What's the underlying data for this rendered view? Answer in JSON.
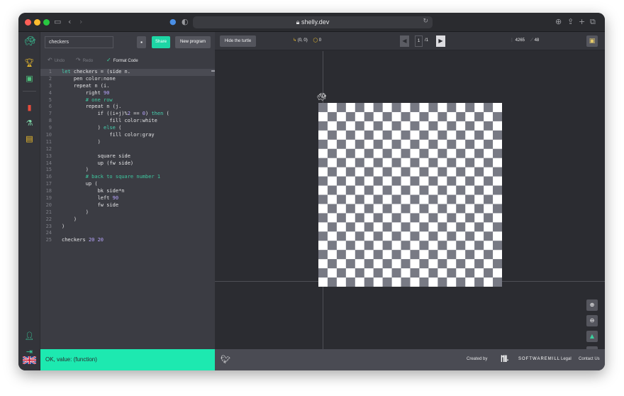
{
  "browser": {
    "url": "shelly.dev",
    "lock_icon": "lock-icon",
    "traffic_colors": [
      "#fe5f57",
      "#febc2e",
      "#28c840"
    ]
  },
  "sidebar": {
    "icons": [
      "logo-icon",
      "trophy-icon",
      "gallery-icon",
      "book-icon",
      "flask-icon",
      "teacher-icon",
      "user-settings-icon",
      "logout-icon"
    ]
  },
  "editor": {
    "program_name": "checkers",
    "share_label": "Share",
    "new_program_label": "New program",
    "undo_label": "Undo",
    "redo_label": "Redo",
    "format_label": "Format Code",
    "lines": [
      {
        "n": "1",
        "text": "let checkers = (side n.",
        "active": true
      },
      {
        "n": "2",
        "text": "    pen color:none"
      },
      {
        "n": "3",
        "text": "    repeat n (i."
      },
      {
        "n": "4",
        "text": "        right 90"
      },
      {
        "n": "5",
        "text": "        # one row",
        "comment": true
      },
      {
        "n": "6",
        "text": "        repeat n (j."
      },
      {
        "n": "7",
        "text": "            if ((i+j)%2 == 0) then ("
      },
      {
        "n": "8",
        "text": "                fill color:white"
      },
      {
        "n": "9",
        "text": "            ) else ("
      },
      {
        "n": "10",
        "text": "                fill color:gray"
      },
      {
        "n": "11",
        "text": "            )"
      },
      {
        "n": "12",
        "text": ""
      },
      {
        "n": "13",
        "text": "            square side"
      },
      {
        "n": "14",
        "text": "            up (fw side)"
      },
      {
        "n": "15",
        "text": "        )"
      },
      {
        "n": "16",
        "text": "        # back to square number 1",
        "comment": true
      },
      {
        "n": "17",
        "text": "        up ("
      },
      {
        "n": "18",
        "text": "            bk side*n"
      },
      {
        "n": "19",
        "text": "            left 90"
      },
      {
        "n": "20",
        "text": "            fw side"
      },
      {
        "n": "21",
        "text": "        )"
      },
      {
        "n": "22",
        "text": "    )"
      },
      {
        "n": "23",
        "text": ")"
      },
      {
        "n": "24",
        "text": ""
      },
      {
        "n": "25",
        "text": "checkers 20 20"
      }
    ]
  },
  "status": {
    "message": "OK, value: (function)"
  },
  "canvas": {
    "hide_turtle_label": "Hide the turtle",
    "position": "(0, 0)",
    "angle": "0",
    "page_current": "1",
    "page_total": "/1",
    "steps_count": "4265",
    "lines_count": "48",
    "board_size": 20,
    "light_color": "#ffffff",
    "dark_color": "#787a84"
  },
  "footer": {
    "created_by": "Created by",
    "company_logo": "|'|||.",
    "company_name": "SOFTWAREMILL",
    "legal_label": "Legal",
    "contact_label": "Contact Us"
  },
  "colors": {
    "accent": "#1de9b0",
    "share": "#1dd6a5",
    "keyword": "#46d1b0",
    "comment": "#3ec9a0",
    "number": "#b9a6ff"
  }
}
